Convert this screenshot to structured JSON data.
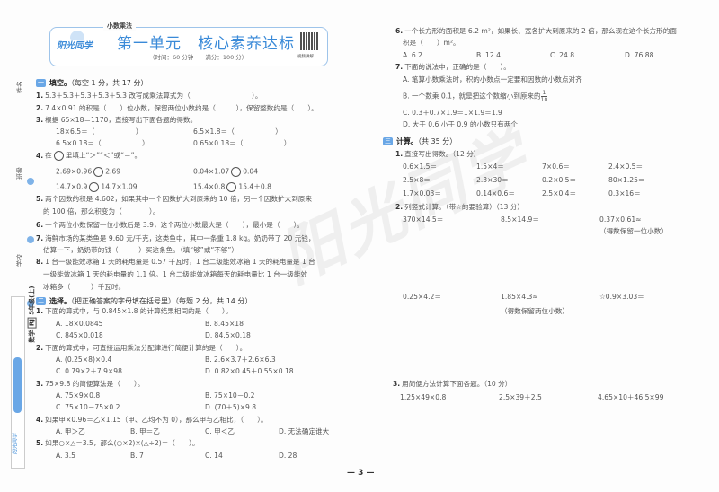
{
  "binding": {
    "name_label": "姓名",
    "class_label": "班级",
    "school_label": "学校",
    "spine_subject": "数学",
    "spine_edition": "RJ",
    "spine_grade": "5年级(上)",
    "spine_logo": "阳光同学"
  },
  "header": {
    "unit_topic": "小数乘法",
    "logo": "阳光同学",
    "title": "第一单元　核心素养达标",
    "time": "（时间：60 分钟　　满分：100 分）",
    "qr_caption": "视频讲解"
  },
  "watermark": "阳光同学",
  "section1": {
    "badge": "一",
    "title": "填空。",
    "note": "（每空 1 分，共 17 分）",
    "q1": "5.3＋5.3＋5.3＋5.3＋5.3 改写成乘法算式为（　　　　　　　　　）。",
    "q2": "7.4×0.91 的积是（　　）位小数，保留两位小数约是（　　　），保留整数约是（　　）。",
    "q3": "根据 65×18＝1170，直接写出下面各题的得数。",
    "q3_items": [
      "18×6.5＝（　　　　　　）",
      "6.5×1.8＝（　　　　　　）",
      "6.5×0.18＝（　　　　　　）",
      "0.65×0.18＝（　　　　　　）"
    ],
    "q4_pre": "在",
    "q4_post": "里填上“＞”“＜”或“＝”。",
    "q4_items": [
      [
        "2.69×0.96",
        "2.69"
      ],
      [
        "0.04×1.07",
        "0.04"
      ],
      [
        "14.7×0.9",
        "14.7×1.09"
      ],
      [
        "15.4×0.8",
        "15.4＋0.8"
      ]
    ],
    "q5_a": "两个因数的积是 4.602，如果其中一个因数扩大到原来的 10 倍，另一个因数扩大到原来",
    "q5_b": "的 100 倍，那么积变为（　　　　）。",
    "q6": "一个两位小数保留一位小数后是 3.9，这个两位小数最大是（　　），最小是（　　）。",
    "q7_a": "海鲜市场的某类鱼是 9.60 元/千克，这类鱼中，其中一条重 1.8 kg。奶奶带了 20 元钱，",
    "q7_b": "估算一下，奶奶带的钱（　　　）买这条鱼。（填“够”或“不够”）",
    "q8_a": "1 台一级能效冰箱 1 天的耗电量是 0.57 千瓦时，1 台二级能效冰箱 1 天的耗电量是 1 台",
    "q8_b": "一级能效冰箱 1 天的耗电量的 1.1 倍。1 台二级能效冰箱每天的耗电量比 1 台一级能效",
    "q8_c": "冰箱多（　　　）千瓦时。"
  },
  "section2": {
    "badge": "二",
    "title": "选择。",
    "note": "（把正确答案的字母填在括号里）（每题 2 分，共 14 分）",
    "questions": [
      {
        "stem": "下面的算式中，与 0.845×1.8 的计算结果相同的是（　　）。",
        "options": [
          "A. 18×0.0845",
          "B. 8.45×18",
          "C. 845×0.018",
          "D. 84.5×0.18"
        ]
      },
      {
        "stem": "下面的算式中，可直接运用乘法分配律进行简便计算的是（　　）。",
        "options": [
          "A. (0.25×8)×0.4",
          "B. 2.6×3.7＋2.6×6.3",
          "C. 0.79×2＋7.9×98",
          "D. 0.82×0.45＋0.55×0.18"
        ]
      },
      {
        "stem": "75×9.8 的简便算法是（　　）。",
        "options": [
          "A. 75×9×0.8",
          "B. 75×10－0.2",
          "C. 75×10－75×0.2",
          "D. (70＋5)×9.8"
        ]
      },
      {
        "stem": "如果甲×0.96＝乙×1.15（甲、乙均不为 0），那么甲与乙相比，（　　）。",
        "options": [
          "A. 甲＞乙",
          "B. 甲＝乙",
          "C. 甲＜乙",
          "D. 无法确定谁大"
        ]
      },
      {
        "stem": "如果○×△＝3.5，那么(○×2)×(△÷2)＝（　　）。",
        "options": [
          "A. 3.5",
          "B. 7",
          "C. 14",
          "D. 28"
        ]
      },
      {
        "stem_a": "一个长方形的面积是 6.2 m²，如果长、宽各扩大到原来的 2 倍，那么现在这个长方形的面",
        "stem_b": "积是（　　）m²。",
        "options": [
          "A. 6.2",
          "B. 12.4",
          "C. 24.8",
          "D. 76.88"
        ]
      },
      {
        "stem": "下面的说法中，正确的是（　　）。",
        "options": [
          "A. 笔算小数乘法时，积的小数点一定要和因数的小数点对齐",
          "B. 一个数乘 0.1，就是把这个数缩小到原来的",
          "C. 0.3＋0.7×1.9＝1×1.9＝1.9",
          "D. 大于 0.6 小于 0.9 的小数只有两个"
        ],
        "fraction": {
          "num": "1",
          "den": "10"
        }
      }
    ]
  },
  "section3": {
    "badge": "三",
    "title": "计算。",
    "note": "（共 35 分）",
    "q1": "直接写出得数。（12 分）",
    "q1_items": [
      "0.6×1.5＝",
      "1.5×4＝",
      "7×0.6＝",
      "2.4×0.5＝",
      "2.5×8＝",
      "2.3×30＝",
      "0.2×0.5＝",
      "80×1.25＝",
      "1.7×0.03＝",
      "0.14×0.6＝",
      "2.5×0.4＝",
      "0.3×16＝"
    ],
    "q2": "列竖式计算。（带☆的要验算）（13 分）",
    "q2_items": [
      "370×14.5＝",
      "8.5×14.9＝",
      "0.37×0.61≈",
      "0.25×4.2＝",
      "1.85×4.3≈",
      "☆0.9×3.03＝"
    ],
    "q2_notes": [
      "（得数保留一位小数）",
      "（得数保留两位小数）"
    ],
    "q3": "用简便方法计算下面各题。（10 分）",
    "q3_items": [
      "1.25×49×0.8",
      "2.5×39＋2.5",
      "4.65×10＋46.5×99"
    ]
  },
  "page_number": "3"
}
